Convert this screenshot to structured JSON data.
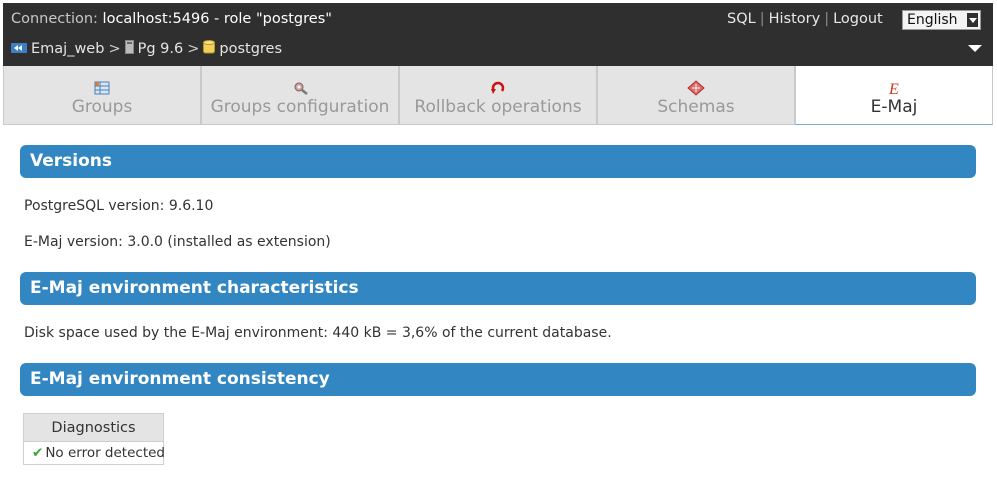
{
  "topbar": {
    "connection_prefix": "Connection: ",
    "connection_value": "localhost:5496",
    "connection_role": " - role \"postgres\"",
    "links": {
      "sql": "SQL",
      "history": "History",
      "logout": "Logout"
    },
    "language": "English"
  },
  "breadcrumb": {
    "app": "Emaj_web",
    "server": "Pg 9.6",
    "database": "postgres"
  },
  "tabs": [
    {
      "label": "Groups",
      "icon": "groups-icon"
    },
    {
      "label": "Groups configuration",
      "icon": "config-icon"
    },
    {
      "label": "Rollback operations",
      "icon": "rollback-icon"
    },
    {
      "label": "Schemas",
      "icon": "schemas-icon"
    },
    {
      "label": "E-Maj",
      "icon": "emaj-icon",
      "active": true
    }
  ],
  "versions": {
    "title": "Versions",
    "postgres": "PostgreSQL version: 9.6.10",
    "emaj": "E-Maj version: 3.0.0 (installed as extension)"
  },
  "environment": {
    "title": "E-Maj environment characteristics",
    "disk": "Disk space used by the E-Maj environment: 440 kB = 3,6% of the current database."
  },
  "consistency": {
    "title": "E-Maj environment consistency",
    "table_header": "Diagnostics",
    "result": "No error detected"
  },
  "colors": {
    "section_bg": "#3286c1",
    "topbar_bg": "#2f2f2f",
    "tab_bg": "#e4e4e4"
  }
}
